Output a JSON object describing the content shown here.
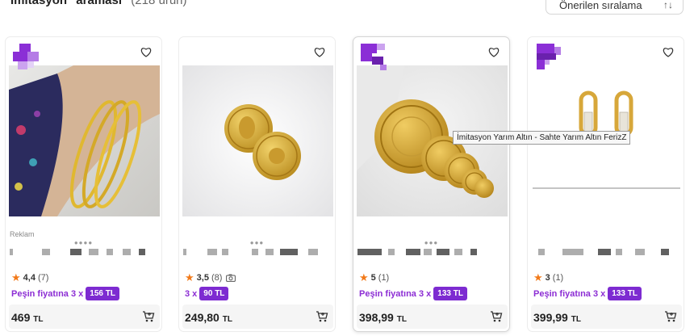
{
  "header": {
    "results_title": "İmitasyon \"aramasi\"",
    "results_count": "(218 ürün)",
    "sort_label": "Önerilen sıralama",
    "sort_icon": "sort-arrows-icon"
  },
  "cards": [
    {
      "sponsor_label": "Reklam",
      "rating": "4,4",
      "rating_count": "(7)",
      "promo_text": "Peşin fiyatına 3 x",
      "promo_badge": "156 TL",
      "price_main": "469",
      "price_unit": "TL"
    },
    {
      "rating": "3,5",
      "rating_count": "(8)",
      "promo_text": "3 x",
      "promo_badge": "90 TL",
      "price_main": "249,80",
      "price_unit": "TL"
    },
    {
      "rating": "5",
      "rating_count": "(1)",
      "promo_text": "Peşin fiyatına 3 x",
      "promo_badge": "133 TL",
      "price_main": "398,99",
      "price_unit": "TL"
    },
    {
      "rating": "3",
      "rating_count": "(1)",
      "promo_text": "Peşin fiyatına 3 x",
      "promo_badge": "133 TL",
      "price_main": "399,99",
      "price_unit": "TL"
    }
  ],
  "tooltip": "İmitasyon Yarım Altın - Sahte Yarım Altın FerizZ",
  "colors": {
    "accent_purple": "#7d2bd1",
    "star_orange": "#f27a1a",
    "logo_purple": "#8b2fd6"
  }
}
